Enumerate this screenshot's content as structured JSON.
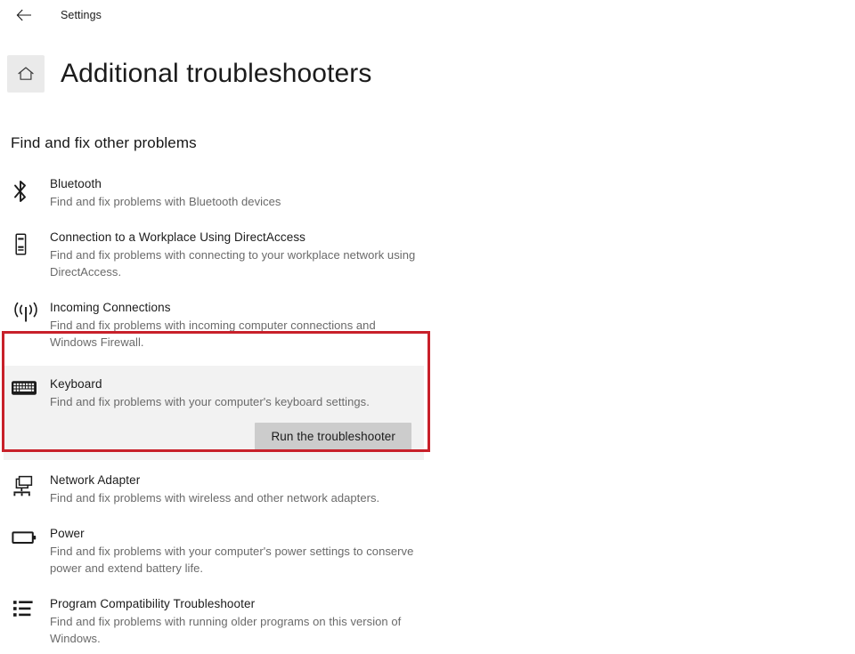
{
  "titlebar": {
    "back_icon": "back-arrow-icon",
    "app_name": "Settings"
  },
  "header": {
    "home_icon": "home-icon",
    "title": "Additional troubleshooters"
  },
  "section": {
    "heading": "Find and fix other problems"
  },
  "colors": {
    "highlight_row_bg": "#f2f2f2",
    "annotation_red": "#c8202a",
    "button_bg": "#cccccc",
    "home_tile_bg": "#eaeaea",
    "title_text": "#1b1b1b",
    "desc_text": "#6a6a6a"
  },
  "items": [
    {
      "icon": "bluetooth-icon",
      "title": "Bluetooth",
      "desc": "Find and fix problems with Bluetooth devices",
      "selected": false
    },
    {
      "icon": "workplace-device-icon",
      "title": "Connection to a Workplace Using DirectAccess",
      "desc": "Find and fix problems with connecting to your workplace network using DirectAccess.",
      "selected": false
    },
    {
      "icon": "incoming-connections-icon",
      "title": "Incoming Connections",
      "desc": "Find and fix problems with incoming computer connections and Windows Firewall.",
      "selected": false
    },
    {
      "icon": "keyboard-icon",
      "title": "Keyboard",
      "desc": "Find and fix problems with your computer's keyboard settings.",
      "selected": true,
      "action_label": "Run the troubleshooter"
    },
    {
      "icon": "network-adapter-icon",
      "title": "Network Adapter",
      "desc": "Find and fix problems with wireless and other network adapters.",
      "selected": false
    },
    {
      "icon": "power-battery-icon",
      "title": "Power",
      "desc": "Find and fix problems with your computer's power settings to conserve power and extend battery life.",
      "selected": false
    },
    {
      "icon": "program-compatibility-icon",
      "title": "Program Compatibility Troubleshooter",
      "desc": "Find and fix problems with running older programs on this version of Windows.",
      "selected": false
    }
  ]
}
